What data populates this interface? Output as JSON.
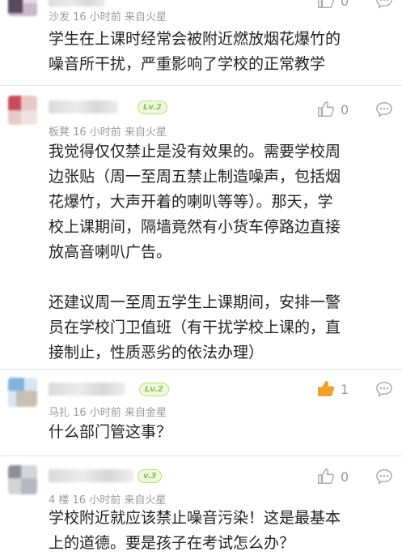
{
  "comments": [
    {
      "location": "沙发 16 小时前 来自火星",
      "lines": [
        "学生在上课时经常会被附近燃放烟花爆竹的",
        "噪音所干扰，严重影响了学校的正常教学"
      ],
      "likes": "0"
    },
    {
      "level": "Lv.2",
      "location": "板凳 16 小时前 来自火星",
      "paragraph1": [
        "我觉得仅仅禁止是没有效果的。需要学校周",
        "边张贴（周一至周五禁止制造噪声，包括烟",
        "花爆竹，大声开着的喇叭等等）。那天，学",
        "校上课期间，隔墙竟然有小货车停路边直接",
        "放高音喇叭广告。"
      ],
      "paragraph2": [
        "还建议周一至周五学生上课期间，安排一警",
        "员在学校门卫值班（有干扰学校上课的，直",
        "接制止，性质恶劣的依法办理）"
      ],
      "likes": "0"
    },
    {
      "level": "Lv.2",
      "location": "马扎 16 小时前 来自金星",
      "lines": [
        "什么部门管这事？"
      ],
      "likes": "1"
    },
    {
      "level": "v.3",
      "location": "4 楼 16 小时前 来自火星",
      "lines": [
        "学校附近就应该禁止噪音污染！这是最基本",
        "上的道德。要是孩子在考试怎么办？"
      ],
      "likes": "0"
    }
  ],
  "colors": {
    "like_active": "#f0a030",
    "icon_gray": "#aaaaaa",
    "level_green": "#8cc04a"
  }
}
